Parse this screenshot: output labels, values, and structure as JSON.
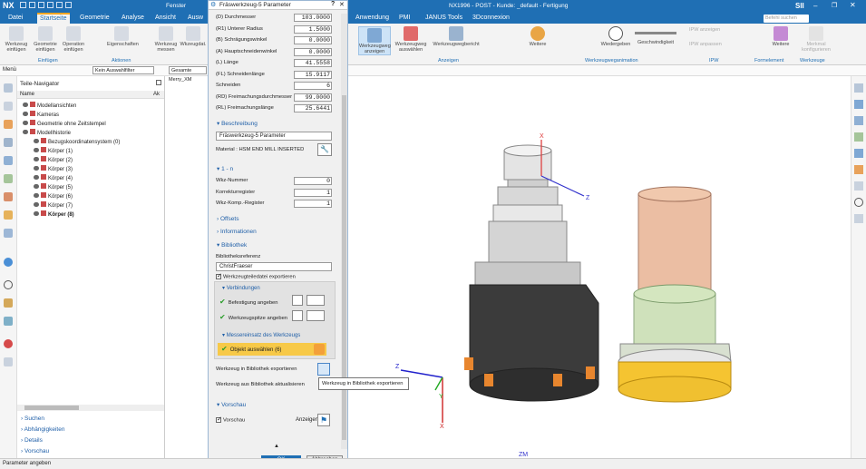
{
  "title_bar": {
    "logo": "NX",
    "window_menu": "Fenster",
    "app_title": "NX1996 - POST - Kunde: _default - Fertigung",
    "brand": "SII",
    "search_placeholder": "Befehl suchen"
  },
  "ribbon_tabs": [
    "Datei",
    "Startseite",
    "Geometrie",
    "Analyse",
    "Ansicht",
    "Ausw",
    "Anwendung",
    "PMI",
    "JANUS Tools",
    "3Dconnexion"
  ],
  "active_tab": "Startseite",
  "ribbon_left": {
    "buttons": [
      "Werkzeug einfügen",
      "Geometrie einfügen",
      "Operation einfügen",
      "Eigenschaften",
      "Werkzeug messen",
      "Wkzeugdat."
    ],
    "groups": [
      "Einfügen",
      "Aktionen"
    ]
  },
  "ribbon_right": {
    "buttons": [
      "Werkzeugweg anzeigen",
      "Werkzeugweg auswählen",
      "Werkzeugwegbericht",
      "Weitere",
      "Wiedergeben",
      "Geschwindigkeit",
      "IPW anzeigen",
      "IPW anpassen",
      "Weitere",
      "Weitere",
      "Merkmal konfigurieren"
    ],
    "groups": [
      "Anzeigen",
      "Werkzeugweganimation",
      "IPW",
      "Formelement",
      "Werkzeuge"
    ]
  },
  "cmdbar": {
    "menu": "Menü",
    "filter": "Kein Auswahlfilter",
    "assembly": "Gesamte Baugr",
    "viewtab": "Merry_XM"
  },
  "navigator": {
    "title": "Teile-Navigator",
    "col_name": "Name",
    "col_other": "Ak",
    "rows": [
      {
        "indent": 0,
        "label": "Modellansichten"
      },
      {
        "indent": 0,
        "label": "Kameras"
      },
      {
        "indent": 0,
        "label": "Geometrie ohne Zeitstempel"
      },
      {
        "indent": 0,
        "label": "Modellhistorie"
      },
      {
        "indent": 1,
        "label": "Bezugskoordinatensystem (0)"
      },
      {
        "indent": 1,
        "label": "Körper (1)"
      },
      {
        "indent": 1,
        "label": "Körper (2)"
      },
      {
        "indent": 1,
        "label": "Körper (3)"
      },
      {
        "indent": 1,
        "label": "Körper (4)"
      },
      {
        "indent": 1,
        "label": "Körper (5)"
      },
      {
        "indent": 1,
        "label": "Körper (6)"
      },
      {
        "indent": 1,
        "label": "Körper (7)"
      },
      {
        "indent": 1,
        "label": "Körper (8)",
        "bold": true
      }
    ],
    "bottom_sections": [
      "Suchen",
      "Abhängigkeiten",
      "Details",
      "Vorschau"
    ]
  },
  "dialog": {
    "title": "Fräswerkzeug-5 Parameter",
    "params": [
      {
        "label": "(D) Durchmesser",
        "value": "103.0000"
      },
      {
        "label": "(R1) Unterer Radius",
        "value": "1.5000"
      },
      {
        "label": "(B) Schrägungswinkel",
        "value": "0.0000"
      },
      {
        "label": "(A) Hauptschneidenwinkel",
        "value": "0.0000"
      },
      {
        "label": "(L) Länge",
        "value": "41.5558"
      },
      {
        "label": "(FL) Schneidenlänge",
        "value": "15.9117"
      },
      {
        "label": "Schneiden",
        "value": "6"
      },
      {
        "label": "(RD) Freimachungsdurchmesser",
        "value": "99.0000"
      },
      {
        "label": "(RL) Freimachungslänge",
        "value": "25.6441"
      }
    ],
    "beschreibung_header": "Beschreibung",
    "beschreibung_value": "Fräswerkzeug-5 Parameter",
    "material_label": "Material : HSM END MILL INSERTED",
    "nummern_header": "1 - n",
    "nummern": [
      {
        "label": "Wkz-Nummer",
        "value": "0"
      },
      {
        "label": "Korrekturregister",
        "value": "1"
      },
      {
        "label": "Wkz-Komp.-Register",
        "value": "1"
      }
    ],
    "offsets_header": "Offsets",
    "info_header": "Informationen",
    "bibliothek_header": "Bibliothek",
    "bib_ref_label": "Bibliotheksreferenz",
    "bib_ref_value": "ChristFraeser",
    "export_file_label": "Werkzeugteiledatei exportieren",
    "verbindungen_header": "Verbindungen",
    "befestigung_label": "Befestigung angeben",
    "spitze_label": "Werkzeugspitze angeben",
    "messeinsatz_header": "Messereinsatz des Werkzeugs",
    "objekt_label": "Objekt auswählen (6)",
    "export_lib_label": "Werkzeug in Bibliothek exportieren",
    "update_lib_label": "Werkzeug aus Bibliothek aktualisieren",
    "tooltip": "Werkzeug in Bibliothek exportieren",
    "vorschau_header": "Vorschau",
    "vorschau_check": "Vorschau",
    "anzeigen_label": "Anzeigen",
    "ok": "OK",
    "cancel": "Abbrechen"
  },
  "viewport": {
    "axis_x": "X",
    "axis_y": "Y",
    "axis_z": "Z",
    "wcs_label": "ZM"
  },
  "status": "Parameter angeben",
  "colors": {
    "accent": "#1f6fb4",
    "tab_highlight": "#f5a623",
    "section_blue": "#1f5fa8",
    "check_green": "#2a9d2a",
    "highlight_row": "#f7c948"
  }
}
